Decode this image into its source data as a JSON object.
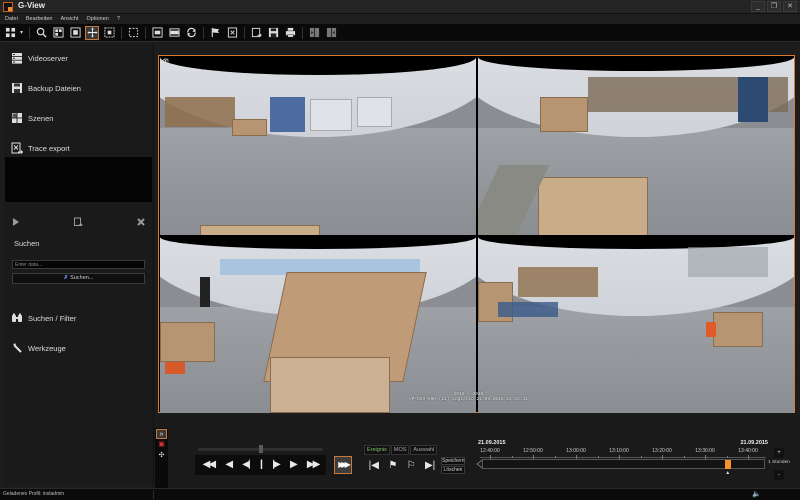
{
  "window": {
    "title": "G-View",
    "controls": {
      "minimize": "_",
      "restore": "❐",
      "close": "✕"
    }
  },
  "menu": [
    "Datei",
    "Bearbeiten",
    "Ansicht",
    "Optionen",
    "?"
  ],
  "toolbar": {
    "buttons": [
      {
        "name": "layout-grid-icon",
        "active": false
      },
      {
        "name": "zoom-icon",
        "active": false
      },
      {
        "name": "grid-view-icon",
        "active": false
      },
      {
        "name": "fullscreen-icon",
        "active": false
      },
      {
        "name": "move-icon",
        "active": true
      },
      {
        "name": "select-area-icon",
        "active": false
      },
      {
        "name": "select-icon",
        "active": false
      },
      {
        "name": "single-view-icon",
        "active": false
      },
      {
        "name": "wide-view-icon",
        "active": false
      },
      {
        "name": "rotate-icon",
        "active": false
      },
      {
        "name": "flag-icon",
        "active": false
      },
      {
        "name": "trace-icon",
        "active": false
      },
      {
        "name": "export-icon",
        "active": false
      },
      {
        "name": "save-icon",
        "active": false
      },
      {
        "name": "print-icon",
        "active": false
      },
      {
        "name": "split-left-icon",
        "active": false
      },
      {
        "name": "split-right-icon",
        "active": false
      }
    ]
  },
  "sidebar": {
    "items": [
      {
        "label": "Videoserver",
        "icon": "server-icon"
      },
      {
        "label": "Backup Dateien",
        "icon": "save-icon"
      },
      {
        "label": "Szenen",
        "icon": "scenes-icon"
      },
      {
        "label": "Trace export",
        "icon": "trace-export-icon"
      }
    ],
    "search": {
      "title": "Suchen",
      "placeholder": "Enter data...",
      "button_label": "Suchen..."
    },
    "bottom_items": [
      {
        "label": "Suchen / Filter",
        "icon": "binoculars-icon"
      },
      {
        "label": "Werkzeuge",
        "icon": "wrench-icon"
      }
    ]
  },
  "video": {
    "osd_line1": "2015 / 2015",
    "osd_line2": "VM-033-GRR (11) Logistic 21.09.2015 13:33:41",
    "overlay_icons": [
      "eye-icon",
      "move-icon"
    ]
  },
  "playback": {
    "speed_position": 0.5,
    "transport": [
      {
        "name": "rewind-fast",
        "glyph": "◀◀"
      },
      {
        "name": "rewind",
        "glyph": "◀"
      },
      {
        "name": "step-back",
        "glyph": "◀|"
      },
      {
        "name": "pause",
        "glyph": "||"
      },
      {
        "name": "step-forward",
        "glyph": "|▶"
      },
      {
        "name": "play",
        "glyph": "▶"
      },
      {
        "name": "fast-forward",
        "glyph": "▶▶"
      }
    ],
    "fast_mode_glyph": "▶▶▶"
  },
  "events": {
    "tabs": [
      {
        "label": "Ereignis",
        "active": true
      },
      {
        "label": "MOS",
        "active": false
      },
      {
        "label": "Auswahl",
        "active": false
      }
    ],
    "nav": [
      {
        "name": "first-event",
        "glyph": "|◀"
      },
      {
        "name": "prev-flag",
        "glyph": "⚑"
      },
      {
        "name": "next-flag",
        "glyph": "⚐"
      },
      {
        "name": "last-event",
        "glyph": "▶|"
      }
    ],
    "save_label": "Speichern",
    "delete_label": "Löschen"
  },
  "timeline": {
    "date_left": "21.09.2015",
    "date_right": "21.09.2015",
    "ticks": [
      "12:40:00",
      "12:50:00",
      "13:00:00",
      "13:10:00",
      "13:20:00",
      "13:30:00",
      "13:40:00"
    ],
    "marker_position": 0.87,
    "zoom_label": "1 Stunden",
    "zoom_in": "+",
    "zoom_out": "-"
  },
  "status": {
    "profile_text": "Geladenes Profil: instadmin"
  },
  "colors": {
    "accent": "#d77a2d",
    "marker": "#f5922a",
    "active_tab": "#7dc36a"
  }
}
